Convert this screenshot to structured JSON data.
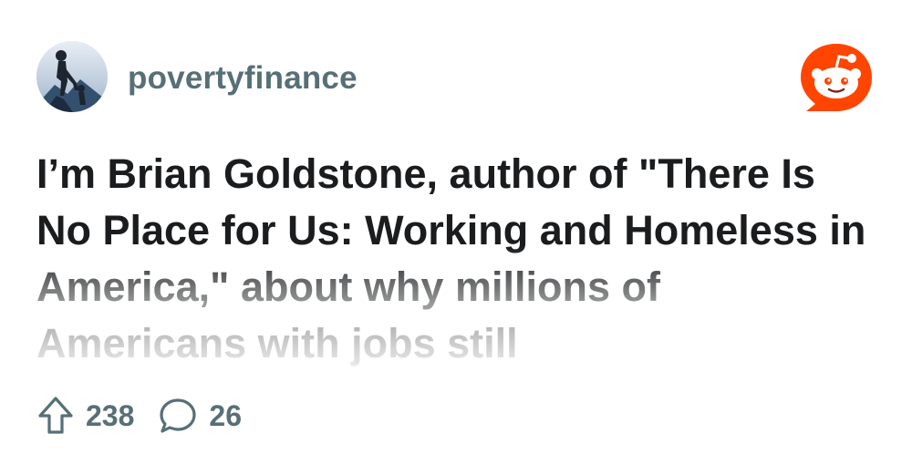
{
  "post": {
    "subreddit": "povertyfinance",
    "title": "I’m Brian Goldstone, author of \"There Is No Place for Us: Working and Homeless in America,\" about why millions of Americans with jobs still"
  },
  "stats": {
    "upvotes": "238",
    "comments": "26"
  },
  "icons": {
    "avatar": "subreddit-avatar",
    "logo": "reddit-logo-icon",
    "upvote": "upvote-arrow-icon",
    "comment": "comment-bubble-icon"
  },
  "colors": {
    "text_primary": "#1a1c1e",
    "text_secondary": "#576f76",
    "brand": "#ff4500"
  }
}
